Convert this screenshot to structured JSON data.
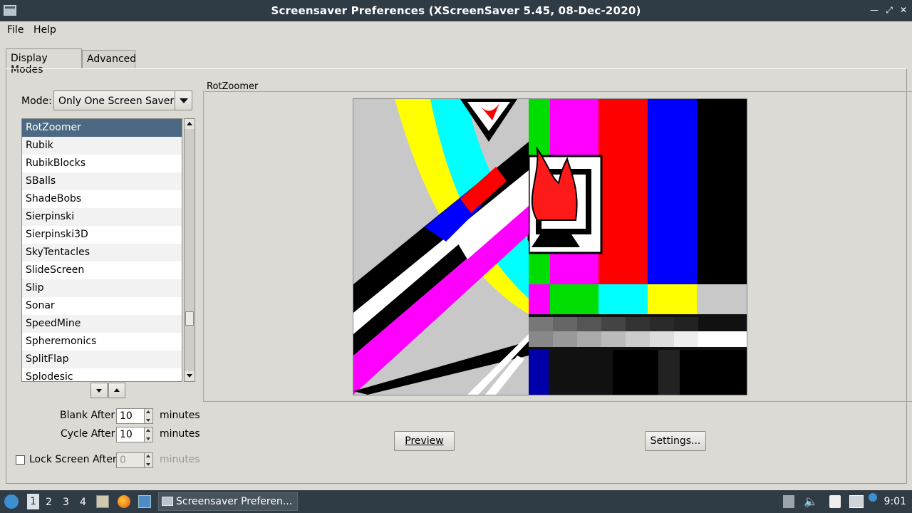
{
  "window": {
    "title": "Screensaver Preferences  (XScreenSaver 5.45, 08-Dec-2020)",
    "controls": [
      "minimize-icon",
      "maximize-icon",
      "close-icon"
    ]
  },
  "menu": {
    "file": "File",
    "help": "Help"
  },
  "tabs": [
    {
      "label": "Display Modes",
      "active": true
    },
    {
      "label": "Advanced",
      "active": false
    }
  ],
  "mode": {
    "label": "Mode:",
    "value": "Only One Screen Saver"
  },
  "savers": [
    "RotZoomer",
    "Rubik",
    "RubikBlocks",
    "SBalls",
    "ShadeBobs",
    "Sierpinski",
    "Sierpinski3D",
    "SkyTentacles",
    "SlideScreen",
    "Slip",
    "Sonar",
    "SpeedMine",
    "Spheremonics",
    "SplitFlap",
    "Splodesic"
  ],
  "selected_saver": "RotZoomer",
  "timing": {
    "blank_label": "Blank After",
    "blank_value": "10",
    "blank_unit": "minutes",
    "cycle_label": "Cycle After",
    "cycle_value": "10",
    "cycle_unit": "minutes",
    "lock_label": "Lock Screen After",
    "lock_value": "0",
    "lock_unit": "minutes",
    "lock_checked": false
  },
  "preview": {
    "frame_title": "RotZoomer",
    "preview_button": "Preview",
    "settings_button": "Settings..."
  },
  "taskbar": {
    "workspaces": [
      "1",
      "2",
      "3",
      "4"
    ],
    "active_workspace": "1",
    "task_title": "Screensaver Preferen...",
    "clock": "9:01"
  },
  "colors": {
    "titlebar": "#2f3b45",
    "selection": "#4b6983",
    "window_bg": "#dcdad5"
  }
}
